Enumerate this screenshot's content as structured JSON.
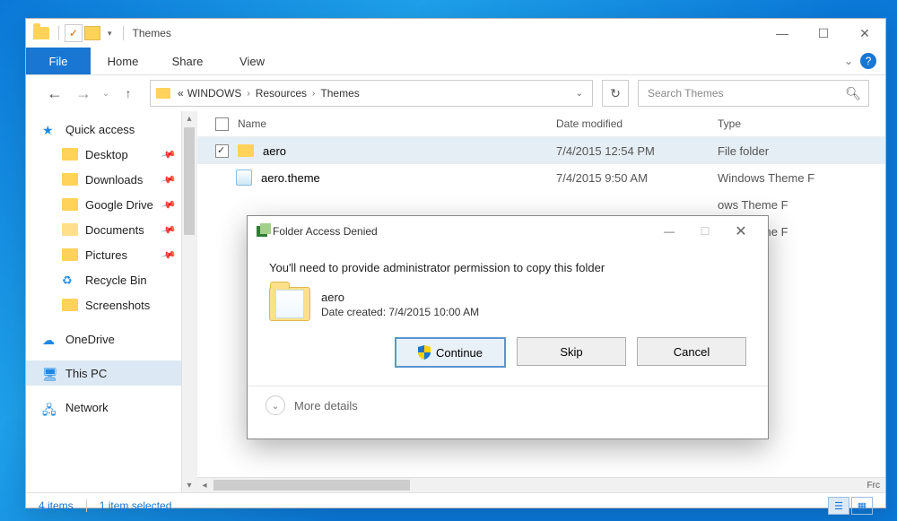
{
  "window": {
    "title": "Themes",
    "tabs": {
      "file": "File",
      "home": "Home",
      "share": "Share",
      "view": "View"
    },
    "nav": {
      "breadcrumb_prefix": "«",
      "segments": [
        "WINDOWS",
        "Resources",
        "Themes"
      ]
    },
    "search_placeholder": "Search Themes",
    "columns": {
      "name": "Name",
      "date": "Date modified",
      "type": "Type"
    },
    "rows": [
      {
        "name": "aero",
        "date": "7/4/2015 12:54 PM",
        "type": "File folder",
        "kind": "folder",
        "selected": true
      },
      {
        "name": "aero.theme",
        "date": "7/4/2015 9:50 AM",
        "type": "Windows Theme F",
        "kind": "theme",
        "selected": false
      },
      {
        "name": "",
        "date": "",
        "type": "ows Theme F",
        "kind": "theme",
        "selected": false
      },
      {
        "name": "",
        "date": "",
        "type": "ows Theme F",
        "kind": "theme",
        "selected": false
      }
    ],
    "sidebar": {
      "quick_access": "Quick access",
      "items": [
        "Desktop",
        "Downloads",
        "Google Drive",
        "Documents",
        "Pictures",
        "Recycle Bin",
        "Screenshots"
      ],
      "onedrive": "OneDrive",
      "this_pc": "This PC",
      "network": "Network"
    },
    "status": {
      "items": "4 items",
      "selected": "1 item selected",
      "frc": "Frc"
    }
  },
  "dialog": {
    "title": "Folder Access Denied",
    "message": "You'll need to provide administrator permission to copy this folder",
    "folder_name": "aero",
    "folder_date": "Date created: 7/4/2015 10:00 AM",
    "continue": "Continue",
    "skip": "Skip",
    "cancel": "Cancel",
    "more": "More details"
  }
}
